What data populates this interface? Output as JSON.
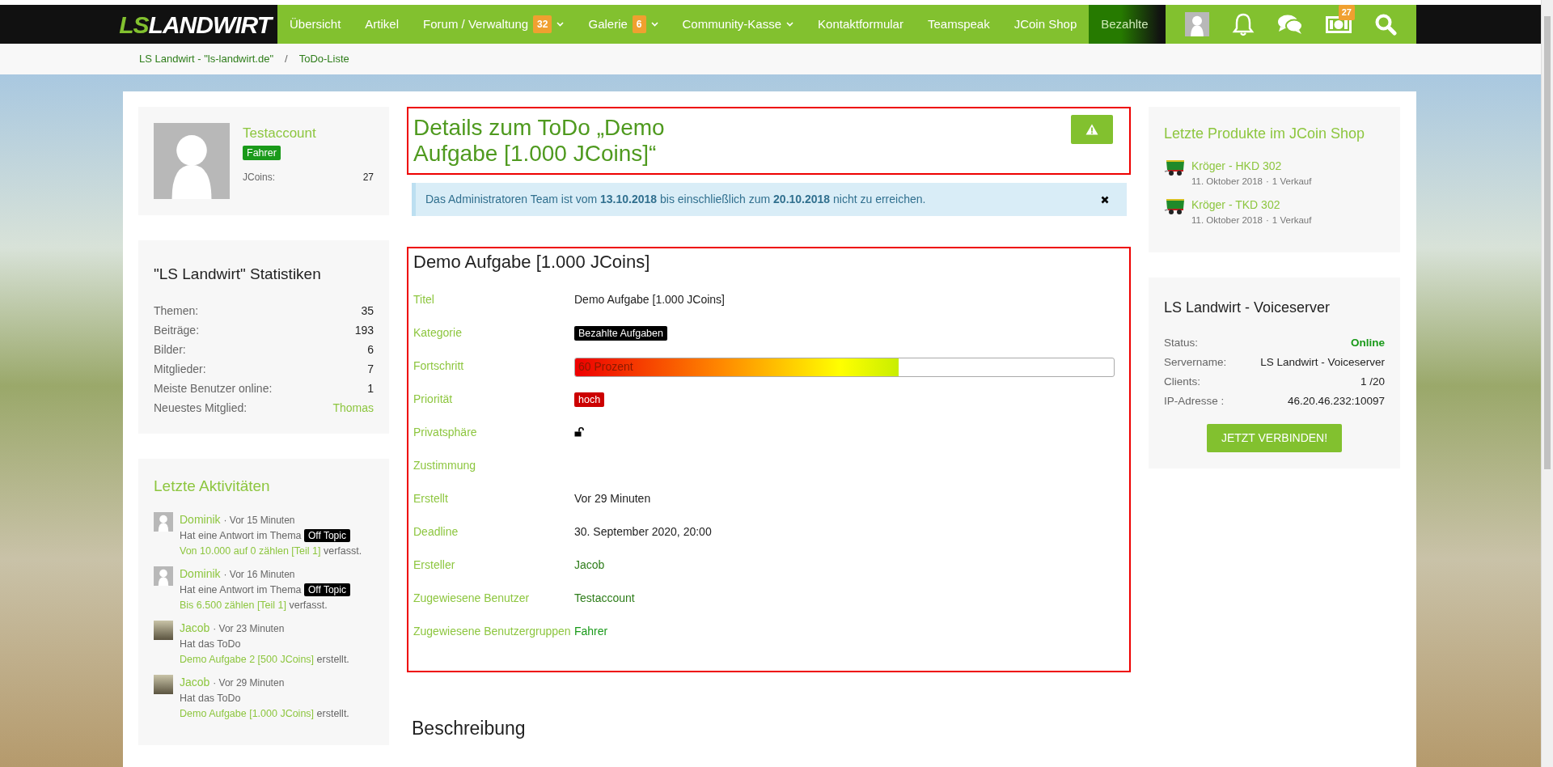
{
  "nav": {
    "logo_left": "LS",
    "logo_right": "LANDWIRT",
    "items": [
      {
        "label": "Übersicht",
        "selected": false,
        "dropdown": false
      },
      {
        "label": "Artikel",
        "selected": false,
        "dropdown": false
      },
      {
        "label": "Forum / Verwaltung",
        "badge": "32",
        "selected": false,
        "dropdown": true
      },
      {
        "label": "Galerie",
        "badge": "6",
        "selected": false,
        "dropdown": true
      },
      {
        "label": "Community-Kasse",
        "selected": false,
        "dropdown": true
      },
      {
        "label": "Kontaktformular",
        "selected": false,
        "dropdown": false
      },
      {
        "label": "Teamspeak",
        "selected": false,
        "dropdown": false
      },
      {
        "label": "JCoin Shop",
        "selected": false,
        "dropdown": false
      },
      {
        "label": "Bezahlte",
        "selected": true,
        "dropdown": false
      }
    ],
    "notification_badge": "27"
  },
  "breadcrumbs": [
    "LS Landwirt - \"ls-landwirt.de\"",
    "ToDo-Liste"
  ],
  "breadcrumb_separator": "/",
  "profile": {
    "name": "Testaccount",
    "group": "Fahrer",
    "jcoins_label": "JCoins:",
    "jcoins": "27"
  },
  "statistics": {
    "title": "\"LS Landwirt\" Statistiken",
    "rows": [
      {
        "label": "Themen:",
        "value": "35",
        "kind": "number"
      },
      {
        "label": "Beiträge:",
        "value": "193",
        "kind": "number"
      },
      {
        "label": "Bilder:",
        "value": "6",
        "kind": "number"
      },
      {
        "label": "Mitglieder:",
        "value": "7",
        "kind": "number"
      },
      {
        "label": "Meiste Benutzer online:",
        "value": "1",
        "kind": "number"
      },
      {
        "label": "Neuestes Mitglied:",
        "value": "Thomas",
        "kind": "link"
      }
    ]
  },
  "activities": {
    "title": "Letzte Aktivitäten",
    "items": [
      {
        "user": "Dominik",
        "kind": "silhouette",
        "time": "· Vor 15 Minuten",
        "text": "Hat eine Antwort im Thema",
        "tag": "Off Topic",
        "link": "Von 10.000 auf 0 zählen [Teil 1]",
        "suffix": "verfasst."
      },
      {
        "user": "Dominik",
        "kind": "silhouette",
        "time": "· Vor 16 Minuten",
        "text": "Hat eine Antwort im Thema",
        "tag": "Off Topic",
        "link": "Bis 6.500 zählen [Teil 1]",
        "suffix": "verfasst."
      },
      {
        "user": "Jacob",
        "kind": "photo",
        "time": "· Vor 23 Minuten",
        "text": "Hat das ToDo",
        "link": "Demo Aufgabe 2 [500 JCoins]",
        "suffix": "erstellt."
      },
      {
        "user": "Jacob",
        "kind": "photo",
        "time": "· Vor 29 Minuten",
        "text": "Hat das ToDo",
        "link": "Demo Aufgabe [1.000 JCoins]",
        "suffix": "erstellt."
      }
    ]
  },
  "page_title": "Details zum ToDo „Demo Aufgabe [1.000 JCoins]“",
  "notice": {
    "text": "Das Administratoren Team ist vom **13.10.2018** bis einschließlich zum **20.10.2018** nicht zu erreichen.",
    "dismissible": true
  },
  "todo": {
    "heading": "Demo Aufgabe [1.000 JCoins]",
    "fields": [
      {
        "label": "Titel",
        "kind": "text",
        "value": "Demo Aufgabe [1.000 JCoins]"
      },
      {
        "label": "Kategorie",
        "kind": "tag",
        "value": "Bezahlte Aufgaben",
        "color": "#000000"
      },
      {
        "label": "Fortschritt",
        "kind": "progress",
        "value": "60 Prozent",
        "level": 0.6
      },
      {
        "label": "Priorität",
        "kind": "tag",
        "value": "hoch",
        "color": "#cc0000"
      },
      {
        "label": "Privatsphäre",
        "kind": "lock"
      },
      {
        "label": "Zustimmung",
        "kind": "empty"
      },
      {
        "label": "Erstellt",
        "kind": "text",
        "value": "Vor 29 Minuten"
      },
      {
        "label": "Deadline",
        "kind": "text",
        "value": "30. September 2020, 20:00"
      },
      {
        "label": "Ersteller",
        "kind": "user",
        "value": "Jacob"
      },
      {
        "label": "Zugewiesene Benutzer",
        "kind": "user",
        "value": "Testaccount"
      },
      {
        "label": "Zugewiesene Benutzergruppen",
        "kind": "group",
        "value": "Fahrer"
      }
    ]
  },
  "description_heading": "Beschreibung",
  "shop": {
    "title": "Letzte Produkte im JCoin Shop",
    "products": [
      {
        "name": "Kröger - HKD 302",
        "date": "11. Oktober 2018",
        "separator": "·",
        "sales": "1 Verkauf"
      },
      {
        "name": "Kröger - TKD 302",
        "date": "11. Oktober 2018",
        "separator": "·",
        "sales": "1 Verkauf"
      }
    ]
  },
  "voiceserver": {
    "title": "LS Landwirt - Voiceserver",
    "rows": [
      {
        "label": "Status:",
        "value": "Online",
        "kind": "status"
      },
      {
        "label": "Servername:",
        "value": "LS Landwirt - Voiceserver",
        "kind": "text"
      },
      {
        "label": "Clients:",
        "value": "1 /20",
        "kind": "text"
      },
      {
        "label": "IP-Adresse :",
        "value": "46.20.46.232:10097",
        "kind": "text"
      }
    ],
    "button": "JETZT VERBINDEN!"
  }
}
